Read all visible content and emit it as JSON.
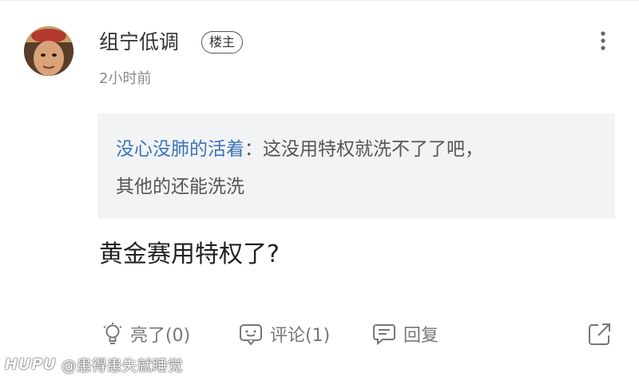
{
  "post": {
    "author": "组宁低调",
    "badge": "楼主",
    "time": "2小时前",
    "quote": {
      "author": "没心没肺的活着",
      "separator": "：",
      "line1": "这没用特权就洗不了了吧，",
      "line2": "其他的还能洗洗"
    },
    "content": "黄金赛用特权了?"
  },
  "actions": {
    "like_label": "亮了(0)",
    "comment_label": "评论(1)",
    "reply_label": "回复"
  },
  "watermark": {
    "logo": "HUPU",
    "handle": "@患得患失就睡觉"
  },
  "icons": [
    "avatar",
    "more-icon",
    "like-icon",
    "comment-icon",
    "reply-icon",
    "share-icon"
  ],
  "colors": {
    "quote_author": "#3f74b8",
    "quote_bg": "#f2f3f5",
    "meta_gray": "#8a8a8a"
  }
}
